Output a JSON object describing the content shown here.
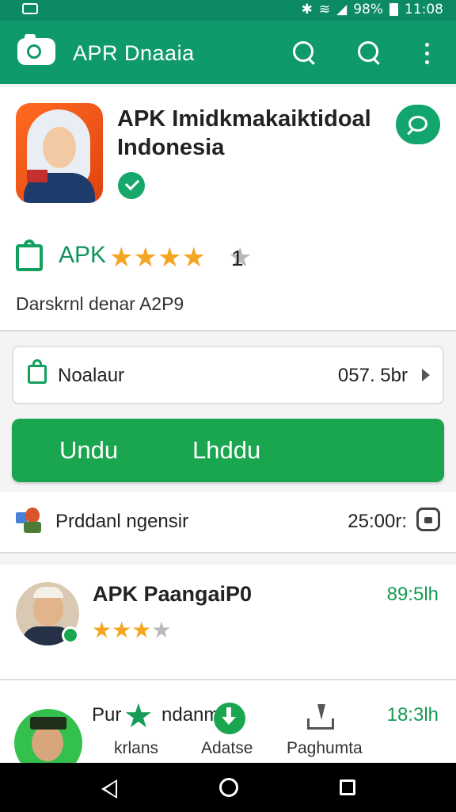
{
  "status_bar": {
    "battery": "98%",
    "time": "11:08"
  },
  "app_bar": {
    "title": "APR Dnaaia"
  },
  "app": {
    "title_line1": "APK Imidkmakaiktidoal",
    "title_line2": "Indonesia",
    "label": "APK",
    "stars": [
      "★",
      "★",
      "★",
      "★"
    ],
    "star_empty": "★",
    "rating_value": "1",
    "developer": "Darskrnl denar A2P9"
  },
  "file": {
    "label": "Noalaur",
    "size": "057. 5br"
  },
  "download_button": {
    "label_1": "Undu",
    "label_2": "Lhddu"
  },
  "version": {
    "label": "Prddanl ngensir",
    "value": "25:00r:"
  },
  "list": [
    {
      "name": "APK PaangaiP0",
      "stars": "★★★",
      "star_empty": "★",
      "size": "89:5lh"
    },
    {
      "name_a": "Pur",
      "name_b": "ndanm",
      "size": "18:3lh",
      "tabs": [
        "krlans",
        "Adatse",
        "Paghumta"
      ]
    }
  ],
  "colors": {
    "primary": "#0f9a6e",
    "accent_green": "#1aa64f",
    "star": "#f4a523"
  },
  "icons": [
    "camera-icon",
    "search-icon",
    "more-vert-icon",
    "verified-icon",
    "shopping-bag-icon",
    "lock-icon",
    "download-icon",
    "back-icon",
    "home-icon",
    "recents-icon"
  ]
}
